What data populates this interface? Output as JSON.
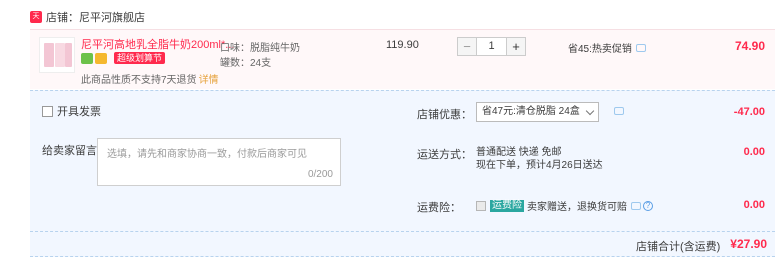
{
  "shop": {
    "icon_text": "天猫",
    "label": "店铺：尼平河旗舰店"
  },
  "item": {
    "title": "尼平河高地乳全脂牛奶200ml*...",
    "promo_badge": "超级划算节",
    "return_note": "此商品性质不支持7天退货",
    "return_link": "详情",
    "attr_taste": "口味：脱脂纯牛奶",
    "attr_count": "罐数：24支",
    "price": "119.90",
    "qty": "1",
    "minus": "−",
    "plus": "+",
    "promo": "省45:热卖促销",
    "total": "74.90"
  },
  "options": {
    "invoice_label": "开具发票",
    "message_label": "给卖家留言：",
    "message_placeholder": "选填，请先和商家协商一致，付款后商家可见",
    "message_count": "0/200",
    "discount_label": "店铺优惠：",
    "discount_value": "省47元:清仓脱脂 24盒",
    "discount_amount": "-47.00",
    "shipping_label": "运送方式：",
    "shipping_line1": "普通配送 快递 免邮",
    "shipping_line2": "现在下单，预计4月26日送达",
    "shipping_amount": "0.00",
    "insurance_label": "运费险：",
    "insurance_tag": "运费险",
    "insurance_desc": "卖家赠送，退换货可赔",
    "insurance_amount": "0.00"
  },
  "summary": {
    "label": "店铺合计(含运费)",
    "total": "¥27.90"
  },
  "colors": {
    "accent": "#ff2a4d",
    "panel": "#f2f7ff"
  }
}
